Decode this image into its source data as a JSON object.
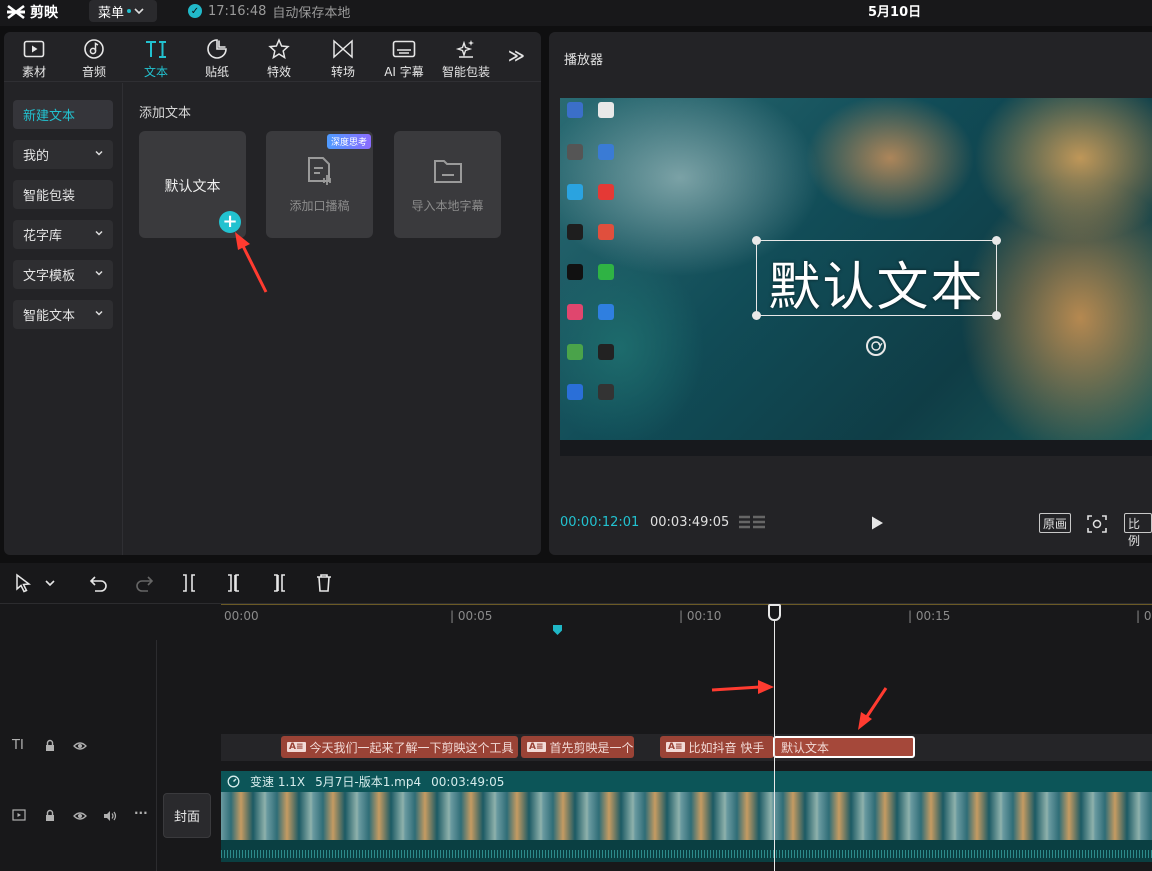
{
  "app": {
    "name": "剪映",
    "menu_label": "菜单"
  },
  "autosave": {
    "time": "17:16:48",
    "text": "自动保存本地"
  },
  "project": {
    "title": "5月10日"
  },
  "tabs": [
    {
      "label": "素材",
      "icon": "media-icon"
    },
    {
      "label": "音频",
      "icon": "audio-icon"
    },
    {
      "label": "文本",
      "icon": "text-icon",
      "active": true
    },
    {
      "label": "贴纸",
      "icon": "sticker-icon"
    },
    {
      "label": "特效",
      "icon": "effects-icon"
    },
    {
      "label": "转场",
      "icon": "transition-icon"
    },
    {
      "label": "AI 字幕",
      "icon": "caption-icon"
    },
    {
      "label": "智能包装",
      "icon": "smart-pack-icon"
    }
  ],
  "side_nav": [
    {
      "label": "新建文本",
      "active": true
    },
    {
      "label": "我的",
      "chevron": true
    },
    {
      "label": "智能包装"
    },
    {
      "label": "花字库",
      "chevron": true
    },
    {
      "label": "文字模板",
      "chevron": true
    },
    {
      "label": "智能文本",
      "chevron": true
    }
  ],
  "content": {
    "section_title": "添加文本",
    "cards": [
      {
        "label": "默认文本"
      },
      {
        "label": "添加口播稿",
        "badge": "深度思考"
      },
      {
        "label": "导入本地字幕"
      }
    ]
  },
  "player": {
    "title": "播放器",
    "overlay_text": "默认文本",
    "time_current": "00:00:12:01",
    "time_total": "00:03:49:05",
    "btn_original": "原画",
    "btn_ratio": "比例"
  },
  "timeline": {
    "ticks": [
      "00:00",
      "| 00:05",
      "| 00:10",
      "| 00:15",
      "| 0"
    ],
    "text_clips": [
      {
        "label": "今天我们一起来了解一下剪映这个工具"
      },
      {
        "label": "首先剪映是一个"
      },
      {
        "label": "比如抖音 快手"
      },
      {
        "label": "默认文本",
        "selected": true
      }
    ],
    "video_clip": {
      "speed": "变速 1.1X",
      "file": "5月7日-版本1.mp4",
      "duration": "00:03:49:05"
    },
    "cover_label": "封面"
  },
  "colors": {
    "accent": "#22c2d0",
    "text_clip": "#9a4336",
    "video_clip": "#0f4c4f",
    "arrow": "#ff3b30"
  }
}
